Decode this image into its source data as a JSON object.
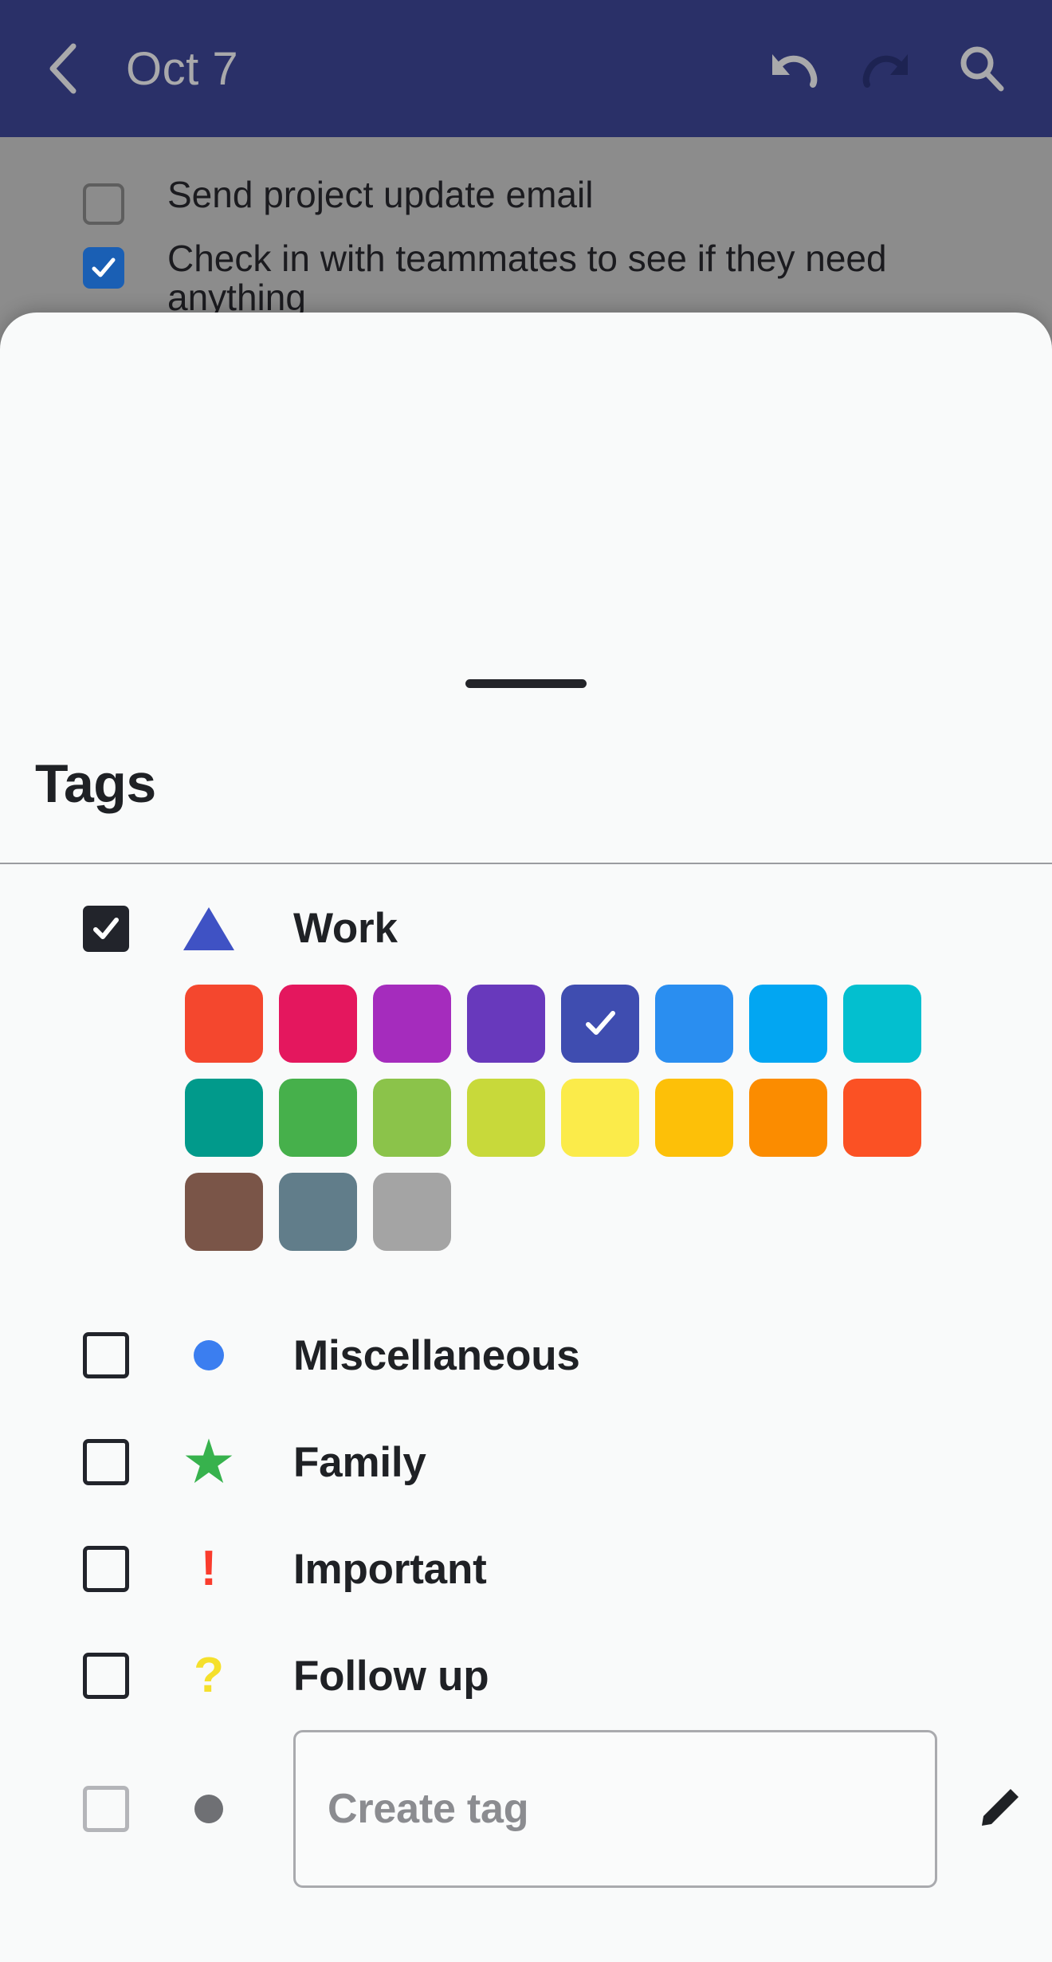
{
  "appbar": {
    "title": "Oct 7",
    "back_icon": "chevron-left-icon",
    "undo_icon": "undo-icon",
    "redo_icon": "redo-icon",
    "search_icon": "search-icon",
    "background": "#2a3068",
    "title_color": "#a9a9ab",
    "undo_color": "#a9a9ab",
    "redo_color": "#1d2352"
  },
  "backdrop": {
    "overlay_color": "#8c8c8c",
    "items": [
      {
        "text": "Send project update email",
        "checked": false
      },
      {
        "text": "Check in with teammates to see if they need anything",
        "checked": true
      }
    ]
  },
  "sheet": {
    "title": "Tags",
    "handle": "drag-handle"
  },
  "tags": [
    {
      "label": "Work",
      "checked": true,
      "symbol": "triangle",
      "symbol_color": "#3f52c4",
      "expanded": true
    },
    {
      "label": "Miscellaneous",
      "checked": false,
      "symbol": "circle",
      "symbol_color": "#3b7ef0",
      "expanded": false
    },
    {
      "label": "Family",
      "checked": false,
      "symbol": "star",
      "symbol_color": "#37b24d",
      "expanded": false
    },
    {
      "label": "Important",
      "checked": false,
      "symbol": "exclamation",
      "symbol_color": "#fa3c2d",
      "expanded": false
    },
    {
      "label": "Follow up",
      "checked": false,
      "symbol": "question",
      "symbol_color": "#f5e02c",
      "expanded": false
    }
  ],
  "symbols": {
    "star": "★",
    "exclamation": "!",
    "question": "?"
  },
  "palette": {
    "selected_index": 4,
    "check_glyph": "✓",
    "rows": [
      [
        "#f4472e",
        "#e4175e",
        "#a52cbd",
        "#6839bc",
        "#3f4db0",
        "#2a8ef0",
        "#02a6f2",
        "#03bfcf"
      ],
      [
        "#019a8b",
        "#46b04b",
        "#8bc34a",
        "#c8d93a",
        "#fbeb4a",
        "#fdc008",
        "#fb8c00",
        "#fb5124"
      ],
      [
        "#7a5548",
        "#617d8a",
        "#a4a4a4"
      ]
    ]
  },
  "create": {
    "placeholder": "Create tag",
    "dot_color": "#6f7074",
    "edit_icon": "pencil-icon",
    "checkbox_state": "unchecked-muted"
  }
}
